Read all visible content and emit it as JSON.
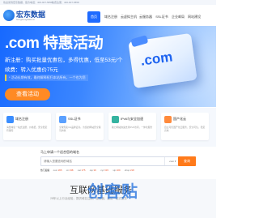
{
  "topbar": {
    "left": "欢迎来到宏东数据，官方电话：400-907-5858",
    "phone": "免费注册：400-907-5858"
  },
  "logo": {
    "name": "宏东数据",
    "sub": "hongdongdata.cn"
  },
  "nav": {
    "items": [
      {
        "label": "首页",
        "active": true
      },
      {
        "label": "域名注册"
      },
      {
        "label": "云虚拟主机"
      },
      {
        "label": "云服务器"
      },
      {
        "label": "SSL证书"
      },
      {
        "label": "企业邮局"
      },
      {
        "label": "网站建设"
      }
    ]
  },
  "hero": {
    "title": ".com 特惠活动",
    "line1": "新注册：购买批量优惠包，多得优惠，低至53元/个",
    "line2": "续费：转入优惠价75元",
    "line3": "* 活动长期有效，最终解释权归本站所有，一个也为您",
    "button": "查看活动",
    "card_text": ".com"
  },
  "services": [
    {
      "title": "域名注册",
      "desc": "海量域名一站式注册，价格低，安全稳定有保障",
      "color": "#3a8dff"
    },
    {
      "title": "SSL证书",
      "desc": "全球知名CA品牌证书，为您的网站安全保驾护航",
      "color": "#5aa0ff"
    },
    {
      "title": "IPv6与安全加速",
      "desc": "助力网站快速支持IPv6访问，一体化服务",
      "color": "#34b3a0"
    },
    {
      "title": "国产化云",
      "desc": "自主可控国产化云服务，安全可信，稳定高效",
      "color": "#ff8a3c"
    }
  ],
  "search": {
    "title": "马上申请一个适合您的域名",
    "placeholder": "请输入您要查询的域名",
    "select": ".com ▾",
    "button": "查询",
    "prices_lead": "热门后缀",
    "prices": [
      {
        "ext": ".com",
        "price": "¥65"
      },
      {
        "ext": ".cn",
        "price": "¥38"
      },
      {
        "ext": ".net",
        "price": "¥75"
      },
      {
        "ext": ".top",
        "price": "¥9"
      },
      {
        "ext": ".xyz",
        "price": "¥15"
      },
      {
        "ext": ".vip",
        "price": "¥29"
      },
      {
        "ext": ".shop",
        "price": "¥18"
      }
    ]
  },
  "bottom": {
    "title": "互联网基础服务",
    "sub": "28年以上行业经验，提供域名注册、服务器、建站一站式服务"
  },
  "watermark": "创客贴"
}
